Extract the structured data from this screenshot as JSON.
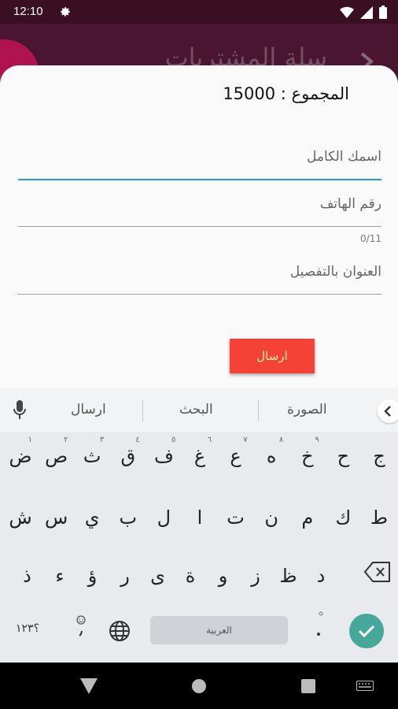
{
  "status_bar": {
    "time": "12:10"
  },
  "app_bar": {
    "title": "سلة المشتريات"
  },
  "sheet": {
    "total_text": "المجموع : 15000",
    "fields": {
      "full_name_placeholder": "اسمك الكامل",
      "phone_placeholder": "رقم الهاتف",
      "phone_counter": "0/11",
      "address_placeholder": "العنوان بالتفصيل"
    },
    "send_label": "ارسال"
  },
  "keyboard": {
    "suggestions": [
      "الصورة",
      "البحث",
      "ارسال"
    ],
    "row1": [
      "ج",
      "ح",
      "خ",
      "ه",
      "ع",
      "غ",
      "ف",
      "ق",
      "ث",
      "ص",
      "ض"
    ],
    "row1_hints": [
      "",
      "",
      "٩",
      "٨",
      "٧",
      "٦",
      "٥",
      "٤",
      "٣",
      "٢",
      "١"
    ],
    "row2": [
      "ط",
      "ك",
      "م",
      "ن",
      "ت",
      "ا",
      "ل",
      "ب",
      "ي",
      "س",
      "ش"
    ],
    "row3": [
      "د",
      "ظ",
      "ز",
      "و",
      "ة",
      "ى",
      "ر",
      "ؤ",
      "ء",
      "ذ"
    ],
    "symbols_label": "؟١٢٣",
    "space_label": "العربية"
  },
  "colors": {
    "status_bar": "#3b0f22",
    "app_bar": "#4a1530",
    "accent_line": "#2196f3",
    "send_button": "#f44336",
    "enter_key": "#45a89a"
  }
}
